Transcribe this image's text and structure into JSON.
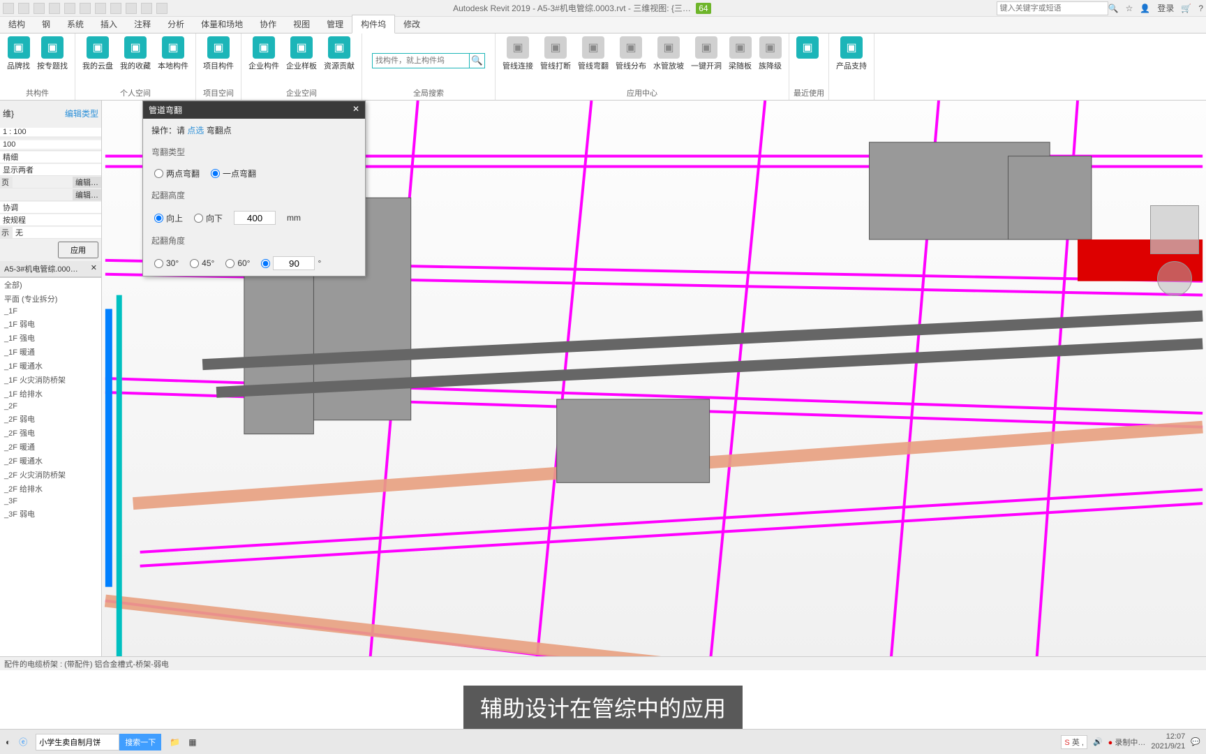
{
  "title_bar": {
    "app_title": "Autodesk Revit 2019 - A5-3#机电管综.0003.rvt - 三维视图: {三…",
    "badge": "64",
    "search_placeholder": "键入关键字或短语",
    "login": "登录"
  },
  "menu": {
    "tabs": [
      "结构",
      "钢",
      "系统",
      "插入",
      "注释",
      "分析",
      "体量和场地",
      "协作",
      "视图",
      "管理",
      "构件坞",
      "修改"
    ],
    "active": "构件坞"
  },
  "ribbon": {
    "groups": [
      {
        "label": "共构件",
        "buttons": [
          {
            "label": "品牌找"
          },
          {
            "label": "按专题找"
          }
        ]
      },
      {
        "label": "个人空间",
        "buttons": [
          {
            "label": "我的云盘"
          },
          {
            "label": "我的收藏"
          },
          {
            "label": "本地构件"
          }
        ]
      },
      {
        "label": "项目空间",
        "buttons": [
          {
            "label": "项目构件"
          }
        ]
      },
      {
        "label": "企业空间",
        "buttons": [
          {
            "label": "企业构件"
          },
          {
            "label": "企业样板"
          },
          {
            "label": "资源贡献"
          }
        ]
      },
      {
        "label": "全局搜索",
        "search_placeholder": "找构件，就上构件坞"
      },
      {
        "label": "应用中心",
        "buttons": [
          {
            "label": "管线连接"
          },
          {
            "label": "管线打断"
          },
          {
            "label": "管线弯翻"
          },
          {
            "label": "管线分布"
          },
          {
            "label": "水管放坡"
          },
          {
            "label": "一键开洞"
          },
          {
            "label": "梁随板"
          },
          {
            "label": "族降级"
          }
        ]
      },
      {
        "label": "最近使用",
        "buttons": [
          {
            "label": ""
          }
        ]
      },
      {
        "label": "",
        "buttons": [
          {
            "label": "产品支持"
          }
        ]
      }
    ]
  },
  "properties": {
    "edit_type": "编辑类型",
    "dim_label": "维}",
    "rows": [
      {
        "value": "1 : 100"
      },
      {
        "value": "100"
      },
      {
        "value": "精细"
      },
      {
        "value": "显示两者"
      },
      {
        "label": "页",
        "value": "",
        "btn": "编辑…"
      },
      {
        "value": "",
        "btn": "编辑…"
      },
      {
        "value": "协调"
      },
      {
        "value": "按规程"
      },
      {
        "label": "示",
        "value": "无"
      }
    ],
    "apply": "应用"
  },
  "browser": {
    "tab_label": "A5-3#机电管综.000…",
    "items": [
      "全部)",
      "平面 (专业拆分)",
      "_1F",
      "_1F 弱电",
      "_1F 强电",
      "_1F 暖通",
      "_1F 暖通水",
      "_1F 火灾消防桥架",
      "_1F 给排水",
      "_2F",
      "_2F 弱电",
      "_2F 强电",
      "_2F 暖通",
      "_2F 暖通水",
      "_2F 火灾消防桥架",
      "_2F 给排水",
      "_3F",
      "_3F 弱电"
    ]
  },
  "float_panel": {
    "title": "管道弯翻",
    "op_label": "操作：请",
    "op_link": "点选",
    "op_suffix": "弯翻点",
    "type_label": "弯翻类型",
    "type_options": [
      "两点弯翻",
      "一点弯翻"
    ],
    "type_selected": "一点弯翻",
    "height_label": "起翻高度",
    "direction_options": [
      "向上",
      "向下"
    ],
    "direction_selected": "向上",
    "height_value": "400",
    "height_unit": "mm",
    "angle_label": "起翻角度",
    "angle_options": [
      "30°",
      "45°",
      "60°",
      "90"
    ],
    "angle_selected_index": 3,
    "angle_unit": "°"
  },
  "status_bar": "配件的电缆桥架 : (带配件) 铝合金槽式-桥架-弱电",
  "subtitle": "辅助设计在管综中的应用",
  "taskbar": {
    "browser_text": "小学生卖自制月饼",
    "search_btn": "搜索一下",
    "ime": "英",
    "recording": "录制中…",
    "time": "12:07",
    "date": "2021/9/21"
  }
}
